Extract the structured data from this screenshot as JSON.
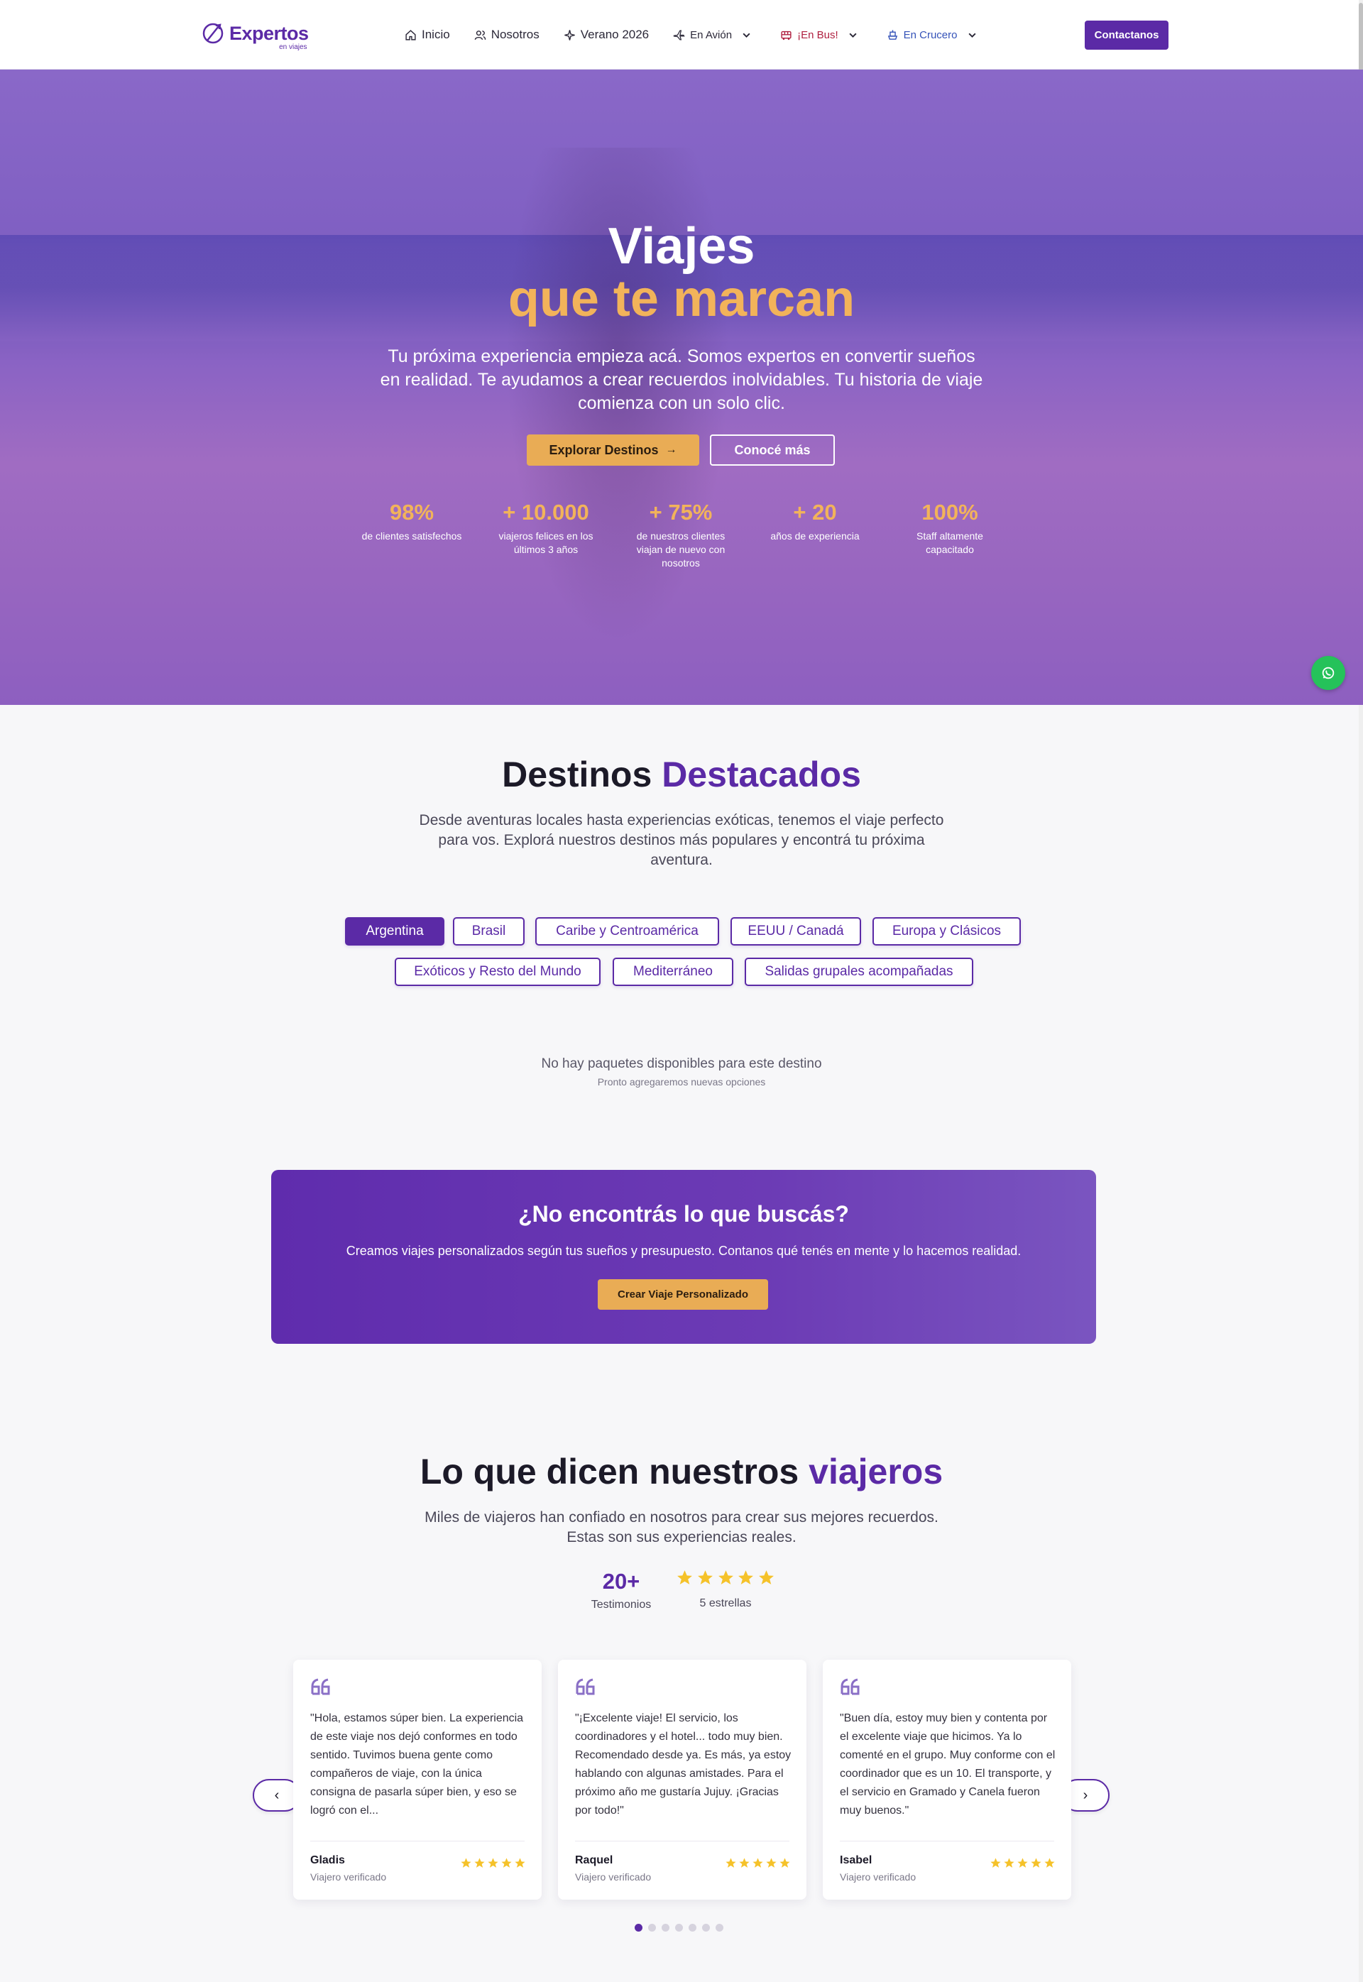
{
  "nav": {
    "logo_main": "Expertos",
    "logo_sub": "en viajes",
    "items": [
      {
        "label": "Inicio",
        "icon": "home-icon"
      },
      {
        "label": "Nosotros",
        "icon": "users-icon"
      },
      {
        "label": "Verano 2026",
        "icon": "sparkles-icon"
      },
      {
        "label": "En Avión",
        "icon": "plane-icon"
      },
      {
        "label": "¡En Bus!",
        "icon": "bus-icon"
      },
      {
        "label": "En Crucero",
        "icon": "ship-icon"
      }
    ],
    "contact": "Contactanos"
  },
  "hero": {
    "title_line1": "Viajes",
    "title_line2": "que te marcan",
    "subtitle": "Tu próxima experiencia empieza acá. Somos expertos en convertir sueños en realidad. Te ayudamos a crear recuerdos inolvidables. Tu historia de viaje comienza con un solo clic.",
    "btn_explore": "Explorar Destinos",
    "btn_more": "Conocé más",
    "stats": [
      {
        "value": "98%",
        "label": "de clientes satisfechos"
      },
      {
        "value": "+ 10.000",
        "label": "viajeros felices en los últimos 3 años"
      },
      {
        "value": "+ 75%",
        "label": "de nuestros clientes viajan de nuevo con nosotros"
      },
      {
        "value": "+ 20",
        "label": "años de experiencia"
      },
      {
        "value": "100%",
        "label": "Staff altamente capacitado"
      }
    ]
  },
  "destinos": {
    "title": "Destinos",
    "title_accent": "Destacados",
    "subtitle": "Desde aventuras locales hasta experiencias exóticas, tenemos el viaje perfecto para vos. Explorá nuestros destinos más populares y encontrá tu próxima aventura.",
    "filters": [
      "Argentina",
      "Brasil",
      "Caribe y Centroamérica",
      "EEUU / Canadá",
      "Europa y Clásicos",
      "Exóticos y Resto del Mundo",
      "Mediterráneo",
      "Salidas grupales acompañadas"
    ],
    "active_filter": "Argentina",
    "empty_title": "No hay paquetes disponibles para este destino",
    "empty_sub": "Pronto agregaremos nuevas opciones"
  },
  "cta": {
    "title": "¿No encontrás lo que buscás?",
    "text": "Creamos viajes personalizados según tus sueños y presupuesto. Contanos qué tenés en mente y lo hacemos realidad.",
    "button": "Crear Viaje Personalizado"
  },
  "testimonios": {
    "title": "Lo que dicen nuestros",
    "title_accent": "viajeros",
    "subtitle": "Miles de viajeros han confiado en nosotros para crear sus mejores recuerdos. Estas son sus experiencias reales.",
    "count_value": "20+",
    "count_label": "Testimonios",
    "rating_stars": 5,
    "rating_label": "5 estrellas",
    "cards": [
      {
        "text": "\"Hola, estamos súper bien. La experiencia de este viaje nos dejó conformes en todo sentido. Tuvimos buena gente como compañeros de viaje, con la única consigna de pasarla súper bien, y eso se logró con el...",
        "name": "Gladis",
        "role": "Viajero verificado",
        "stars": 5
      },
      {
        "text": "\"¡Excelente viaje! El servicio, los coordinadores y el hotel... todo muy bien. Recomendado desde ya. Es más, ya estoy hablando con algunas amistades. Para el próximo año me gustaría Jujuy. ¡Gracias por todo!\"",
        "name": "Raquel",
        "role": "Viajero verificado",
        "stars": 5
      },
      {
        "text": "\"Buen día, estoy muy bien y contenta por el excelente viaje que hicimos. Ya lo comenté en el grupo. Muy conforme con el coordinador que es un 10. El transporte, y el servicio en Gramado y Canela fueron muy buenos.\"",
        "name": "Isabel",
        "role": "Viajero verificado",
        "stars": 5
      }
    ],
    "prev": "‹",
    "next": "›",
    "dots_total": 7,
    "dots_active": 1
  },
  "colors": {
    "brand": "#5b2aa6",
    "accent": "#f2b35a",
    "whatsapp": "#25c25a"
  }
}
